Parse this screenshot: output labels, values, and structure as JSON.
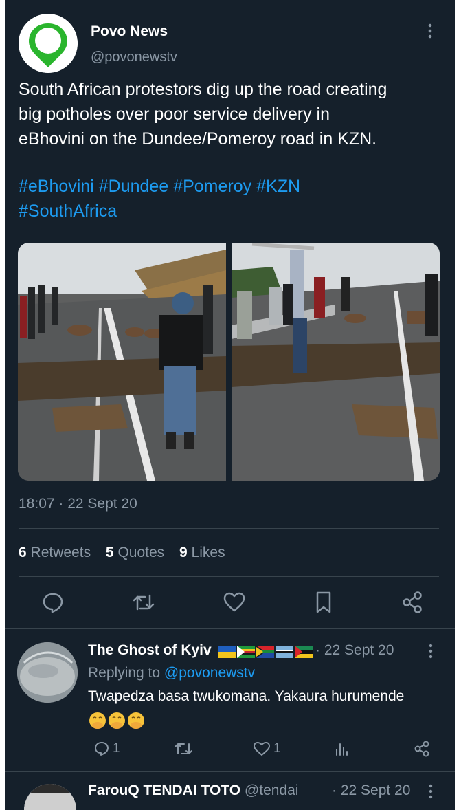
{
  "tweet": {
    "author_name": "Povo News",
    "author_handle": "@povonewstv",
    "text_lines": [
      "South African protestors dig up the road creating",
      "big potholes over poor service delivery in",
      "eBhovini on the Dundee/Pomeroy road in KZN."
    ],
    "hashtags_line1": [
      "#eBhovini",
      "#Dundee",
      "#Pomeroy",
      "#KZN"
    ],
    "hashtags_line2": [
      "#SouthAfrica"
    ],
    "timestamp": "18:07 · 22 Sept 20",
    "stats": {
      "retweets_count": "6",
      "retweets_label": "Retweets",
      "quotes_count": "5",
      "quotes_label": "Quotes",
      "likes_count": "9",
      "likes_label": "Likes"
    },
    "actions": [
      "reply-icon",
      "retweet-icon",
      "like-icon",
      "bookmark-icon",
      "share-icon"
    ]
  },
  "reply": {
    "name": "The Ghost of Kyiv",
    "flags": [
      "ukraine",
      "zimbabwe",
      "south-africa",
      "botswana",
      "mozambique"
    ],
    "date": "· 22 Sept 20",
    "replying_prefix": "Replying to",
    "replying_to": "@povonewstv",
    "text": "Twapedza basa twukomana. Yakaura hurumende",
    "emoji": "🤭🤭🤭",
    "reply_count": "1",
    "like_count": "1"
  },
  "reply2": {
    "name": "FarouQ TENDAI TOTO",
    "handle": "@tendai",
    "date": "· 22 Sept 20"
  },
  "colors": {
    "background": "#15202b",
    "accent": "#1d9bf0",
    "muted": "#8b98a5",
    "divider": "#38444d"
  }
}
